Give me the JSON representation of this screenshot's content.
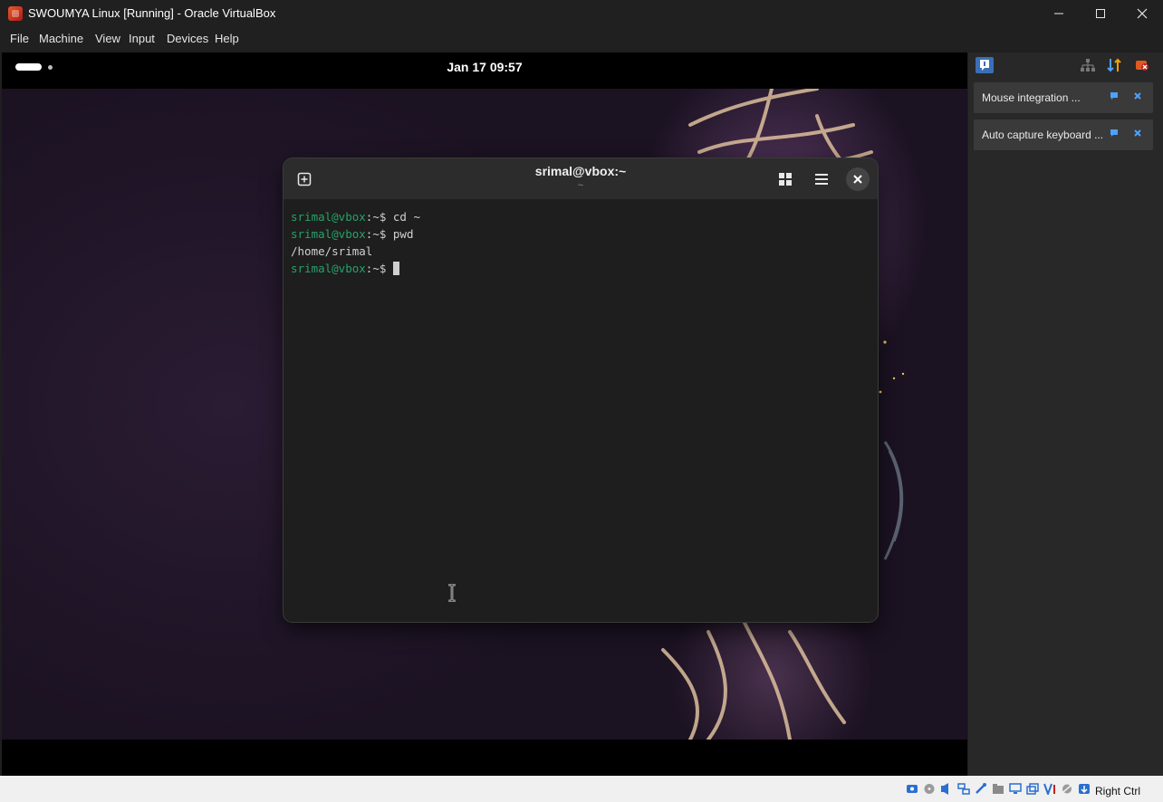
{
  "window": {
    "title": "SWOUMYA Linux [Running] - Oracle VirtualBox",
    "icon": "virtualbox-app-icon",
    "controls": [
      "minimize-icon",
      "maximize-icon",
      "close-icon"
    ]
  },
  "menubar": {
    "items": [
      "File",
      "Machine",
      "View",
      "Input",
      "Devices",
      "Help"
    ]
  },
  "guest": {
    "topbar": {
      "clock": "Jan 17  09:57"
    },
    "terminal": {
      "title": "srimal@vbox:~",
      "subtitle": "~",
      "lines": [
        {
          "prompt": "srimal@vbox",
          "path": ":~",
          "command": "$ cd ~"
        },
        {
          "prompt": "srimal@vbox",
          "path": ":~",
          "command": "$ pwd"
        },
        {
          "output": "/home/srimal"
        },
        {
          "prompt": "srimal@vbox",
          "path": ":~",
          "command": "$ "
        }
      ],
      "colors": {
        "prompt": "#26a269",
        "text": "#d0d0d0",
        "background": "#1e1e1e"
      }
    }
  },
  "notifications": {
    "items": [
      {
        "text": "Mouse integration ..."
      },
      {
        "text": "Auto capture keyboard ..."
      }
    ]
  },
  "statusbar": {
    "host_key": "Right Ctrl",
    "icons": [
      "hard-disk-icon",
      "optical-drive-icon",
      "audio-icon",
      "network-icon",
      "usb-icon",
      "shared-folders-icon",
      "display-icon",
      "recording-icon",
      "cpu-icon",
      "mouse-integration-icon",
      "keyboard-capture-icon"
    ]
  },
  "accent": "#4aa3ff"
}
